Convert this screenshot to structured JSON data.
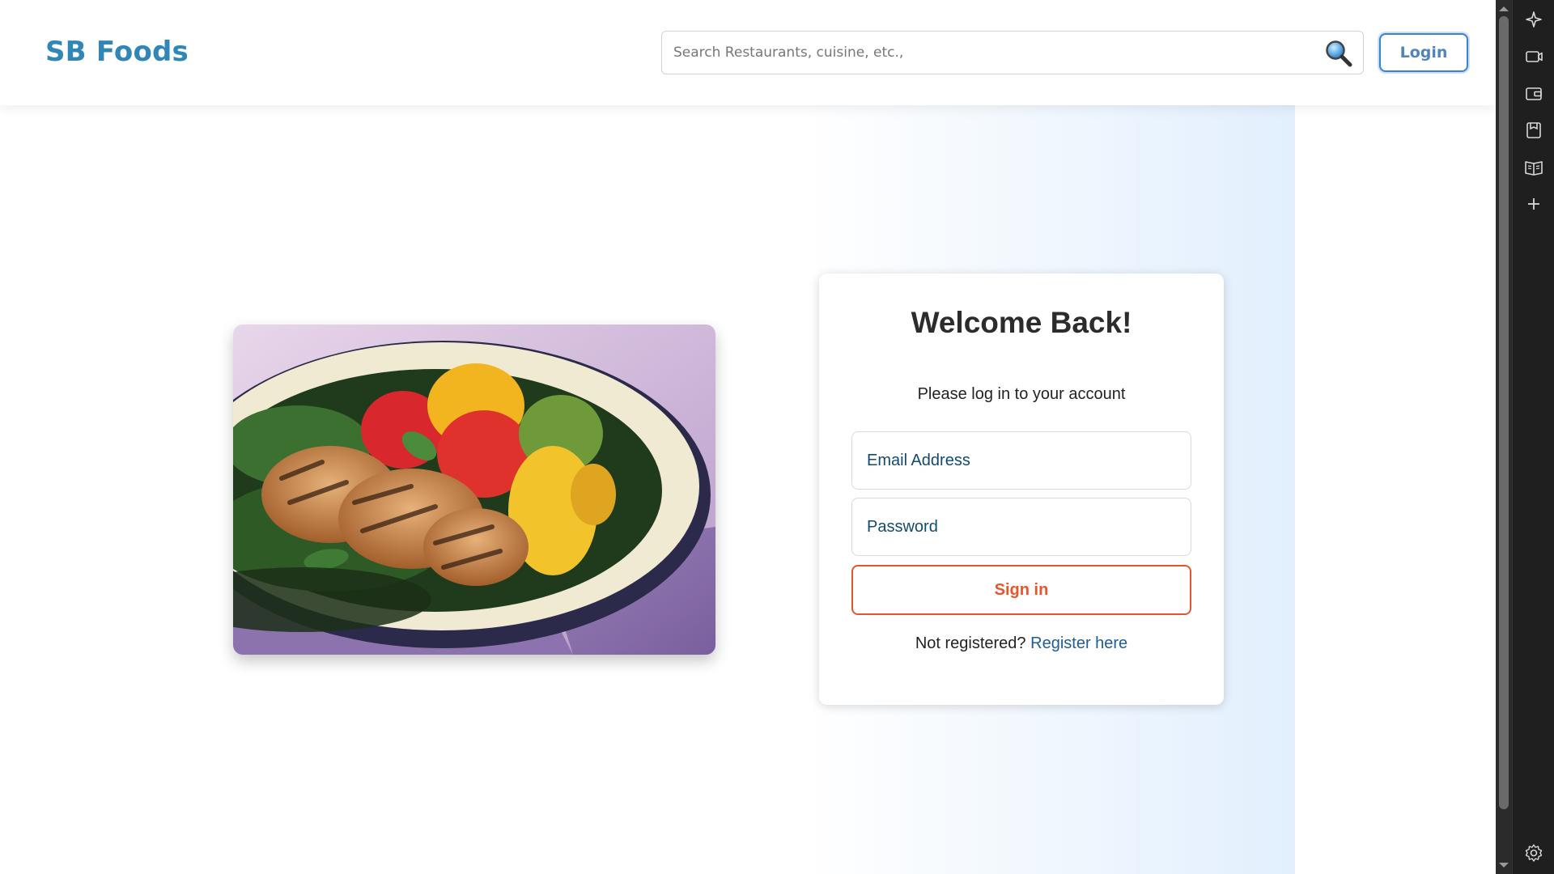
{
  "header": {
    "brand": "SB Foods",
    "search_placeholder": "Search Restaurants, cuisine, etc.,",
    "login_label": "Login"
  },
  "login_card": {
    "title": "Welcome Back!",
    "subtitle": "Please log in to your account",
    "email_placeholder": "Email Address",
    "password_placeholder": "Password",
    "signin_label": "Sign in",
    "register_prompt": "Not registered?",
    "register_link": "Register here"
  },
  "hero_image": {
    "icon": "food-plate-image"
  },
  "browser_sidebar": {
    "icons": [
      "sparkle-icon",
      "video-icon",
      "wallet-icon",
      "bookmark-save-icon",
      "reading-book-icon",
      "plus-icon",
      "settings-gear-icon"
    ]
  },
  "colors": {
    "brand": "#2f86b7",
    "accent_orange": "#e8552c",
    "link_blue": "#1c5d93",
    "login_border": "#3b82d6"
  }
}
